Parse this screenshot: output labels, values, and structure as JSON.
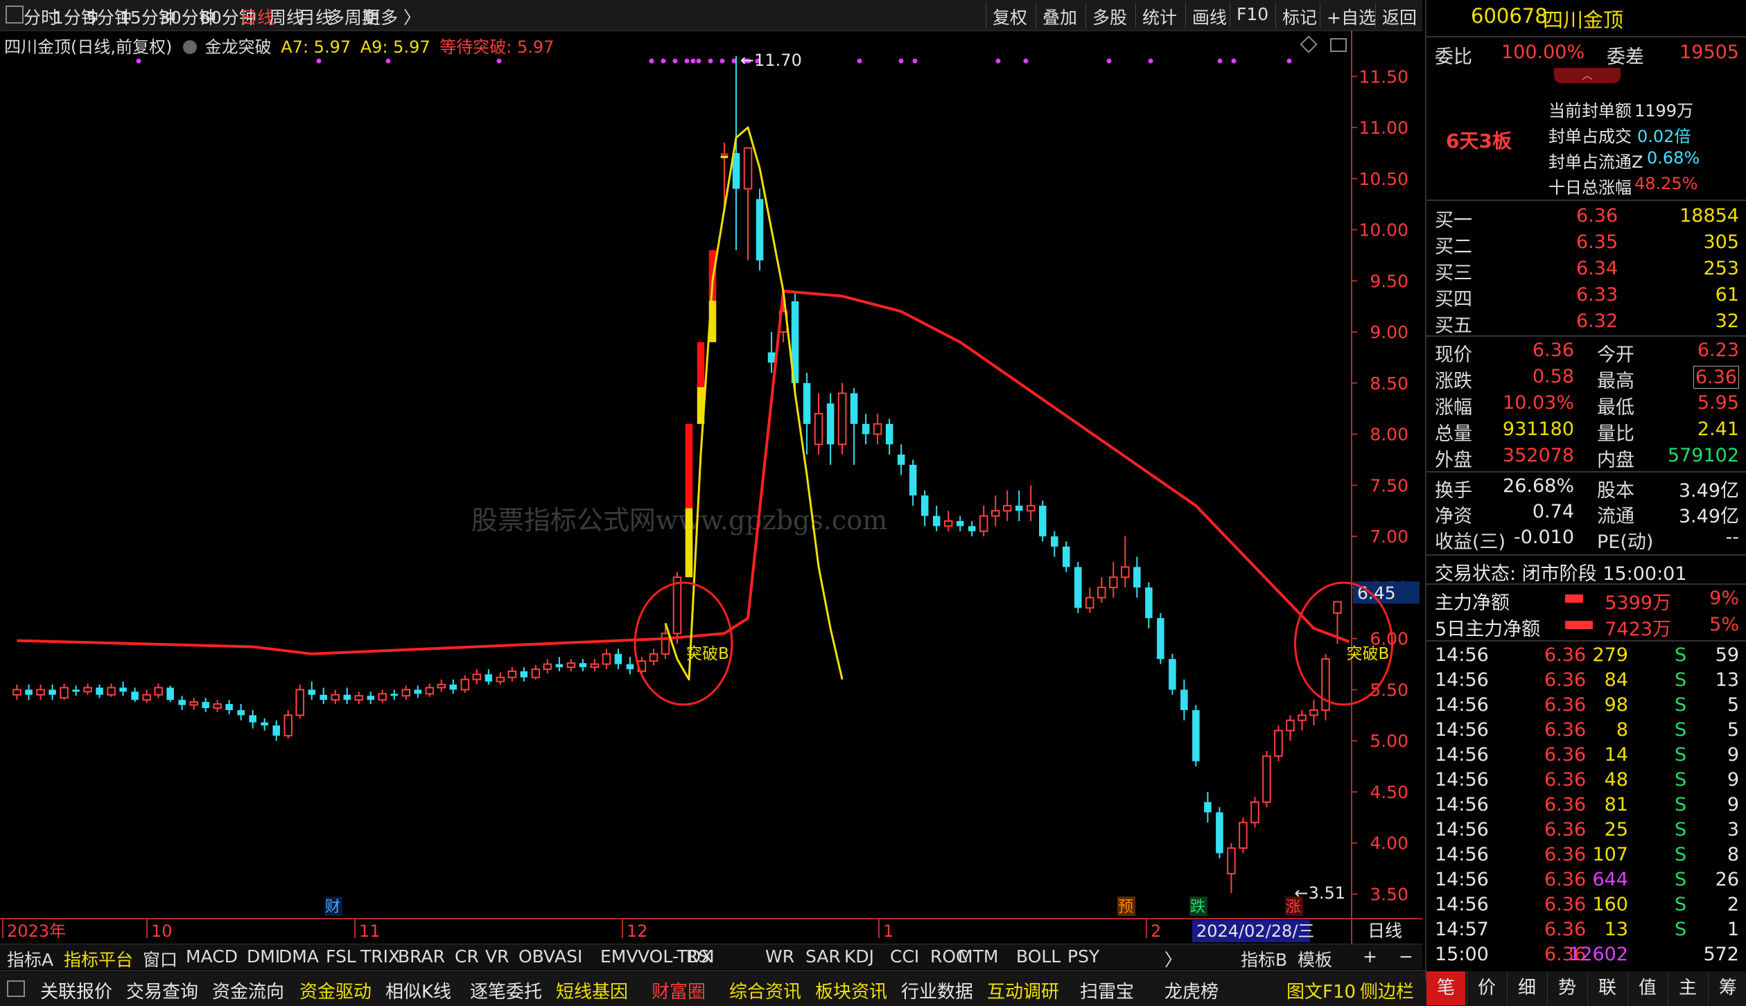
{
  "toolbar": {
    "periods": [
      "分时",
      "1分钟",
      "5分钟",
      "15分钟",
      "30分钟",
      "60分钟",
      "日线",
      "周线",
      "月线",
      "多周期",
      "更多 〉"
    ],
    "active_period": "日线",
    "right_buttons": [
      "复权",
      "叠加",
      "多股",
      "统计",
      "画线",
      "F10",
      "标记",
      "+自选",
      "返回"
    ]
  },
  "legend": {
    "stock_title": "四川金顶(日线,前复权)",
    "indicator_name": "金龙突破",
    "a7": "A7: 5.97",
    "a9": "A9: 5.97",
    "wait": "等待突破: 5.97"
  },
  "watermark": "股票指标公式网www.gpzbgs.com",
  "chart_data": {
    "type": "candlestick",
    "y_ticks": [
      3.5,
      4.0,
      4.5,
      5.0,
      5.5,
      6.0,
      6.5,
      7.0,
      7.5,
      8.0,
      8.5,
      9.0,
      9.5,
      10.0,
      10.5,
      11.0,
      11.5
    ],
    "y_tick_labels": [
      "3.50",
      "4.00",
      "4.50",
      "5.00",
      "5.50",
      "6.00",
      "6.50",
      "7.00",
      "7.50",
      "8.00",
      "8.50",
      "9.00",
      "9.50",
      "10.00",
      "10.50",
      "11.00",
      "11.50"
    ],
    "ylim": [
      3.3,
      11.8
    ],
    "current_price_label": "6.45",
    "high_label": "11.70",
    "low_label": "3.51",
    "candles": [
      [
        5.45,
        5.5,
        5.55,
        5.4
      ],
      [
        5.5,
        5.45,
        5.55,
        5.4
      ],
      [
        5.45,
        5.5,
        5.55,
        5.4
      ],
      [
        5.5,
        5.45,
        5.55,
        5.4
      ],
      [
        5.42,
        5.52,
        5.56,
        5.4
      ],
      [
        5.5,
        5.48,
        5.54,
        5.44
      ],
      [
        5.48,
        5.52,
        5.56,
        5.45
      ],
      [
        5.52,
        5.45,
        5.55,
        5.42
      ],
      [
        5.45,
        5.52,
        5.56,
        5.43
      ],
      [
        5.52,
        5.48,
        5.58,
        5.44
      ],
      [
        5.48,
        5.4,
        5.52,
        5.38
      ],
      [
        5.4,
        5.45,
        5.5,
        5.37
      ],
      [
        5.45,
        5.52,
        5.56,
        5.42
      ],
      [
        5.52,
        5.4,
        5.54,
        5.38
      ],
      [
        5.4,
        5.35,
        5.44,
        5.3
      ],
      [
        5.35,
        5.38,
        5.42,
        5.3
      ],
      [
        5.38,
        5.32,
        5.42,
        5.28
      ],
      [
        5.32,
        5.36,
        5.4,
        5.28
      ],
      [
        5.36,
        5.3,
        5.4,
        5.26
      ],
      [
        5.3,
        5.25,
        5.36,
        5.2
      ],
      [
        5.25,
        5.18,
        5.3,
        5.12
      ],
      [
        5.18,
        5.15,
        5.22,
        5.1
      ],
      [
        5.15,
        5.05,
        5.2,
        5.0
      ],
      [
        5.05,
        5.25,
        5.3,
        5.02
      ],
      [
        5.25,
        5.5,
        5.55,
        5.22
      ],
      [
        5.5,
        5.45,
        5.58,
        5.4
      ],
      [
        5.45,
        5.4,
        5.52,
        5.36
      ],
      [
        5.4,
        5.45,
        5.5,
        5.36
      ],
      [
        5.45,
        5.4,
        5.52,
        5.36
      ],
      [
        5.4,
        5.44,
        5.48,
        5.36
      ],
      [
        5.44,
        5.4,
        5.48,
        5.36
      ],
      [
        5.4,
        5.46,
        5.5,
        5.37
      ],
      [
        5.46,
        5.44,
        5.5,
        5.4
      ],
      [
        5.44,
        5.5,
        5.54,
        5.4
      ],
      [
        5.5,
        5.46,
        5.54,
        5.42
      ],
      [
        5.46,
        5.52,
        5.56,
        5.43
      ],
      [
        5.52,
        5.55,
        5.6,
        5.48
      ],
      [
        5.55,
        5.5,
        5.6,
        5.46
      ],
      [
        5.5,
        5.6,
        5.64,
        5.47
      ],
      [
        5.6,
        5.65,
        5.7,
        5.55
      ],
      [
        5.65,
        5.58,
        5.7,
        5.55
      ],
      [
        5.58,
        5.62,
        5.67,
        5.55
      ],
      [
        5.62,
        5.68,
        5.72,
        5.58
      ],
      [
        5.68,
        5.62,
        5.72,
        5.58
      ],
      [
        5.62,
        5.7,
        5.74,
        5.6
      ],
      [
        5.7,
        5.75,
        5.8,
        5.66
      ],
      [
        5.75,
        5.72,
        5.82,
        5.68
      ],
      [
        5.72,
        5.76,
        5.8,
        5.68
      ],
      [
        5.76,
        5.72,
        5.8,
        5.68
      ],
      [
        5.72,
        5.75,
        5.8,
        5.68
      ],
      [
        5.75,
        5.85,
        5.9,
        5.7
      ],
      [
        5.85,
        5.75,
        5.9,
        5.7
      ],
      [
        5.75,
        5.7,
        5.82,
        5.65
      ],
      [
        5.68,
        5.78,
        5.82,
        5.65
      ],
      [
        5.78,
        5.85,
        5.9,
        5.74
      ],
      [
        5.85,
        6.05,
        6.15,
        5.8
      ],
      [
        6.05,
        6.6,
        6.65,
        5.95
      ],
      [
        6.6,
        8.1,
        8.1,
        6.6
      ],
      [
        8.1,
        8.9,
        8.9,
        8.1
      ],
      [
        8.9,
        9.8,
        9.8,
        8.9
      ],
      [
        10.7,
        10.75,
        10.85,
        10.2
      ],
      [
        10.75,
        10.4,
        11.7,
        9.8
      ],
      [
        10.4,
        10.8,
        10.8,
        9.7
      ],
      [
        10.3,
        9.7,
        10.4,
        9.6
      ],
      [
        8.8,
        8.7,
        9.0,
        8.6
      ],
      [
        9.0,
        9.2,
        9.4,
        8.9
      ],
      [
        9.3,
        8.5,
        9.4,
        8.4
      ],
      [
        8.5,
        8.1,
        8.6,
        7.8
      ],
      [
        7.9,
        8.2,
        8.4,
        7.8
      ],
      [
        8.3,
        7.9,
        8.4,
        7.7
      ],
      [
        7.9,
        8.4,
        8.5,
        7.8
      ],
      [
        8.4,
        8.1,
        8.45,
        7.7
      ],
      [
        8.1,
        8.0,
        8.2,
        7.9
      ],
      [
        8.0,
        8.1,
        8.2,
        7.9
      ],
      [
        8.1,
        7.9,
        8.15,
        7.8
      ],
      [
        7.8,
        7.7,
        7.9,
        7.6
      ],
      [
        7.7,
        7.4,
        7.75,
        7.3
      ],
      [
        7.4,
        7.2,
        7.45,
        7.1
      ],
      [
        7.2,
        7.1,
        7.3,
        7.05
      ],
      [
        7.1,
        7.15,
        7.25,
        7.05
      ],
      [
        7.15,
        7.1,
        7.2,
        7.05
      ],
      [
        7.1,
        7.05,
        7.15,
        7.0
      ],
      [
        7.05,
        7.2,
        7.3,
        7.0
      ],
      [
        7.2,
        7.25,
        7.4,
        7.1
      ],
      [
        7.25,
        7.3,
        7.45,
        7.15
      ],
      [
        7.3,
        7.25,
        7.45,
        7.15
      ],
      [
        7.25,
        7.3,
        7.5,
        7.15
      ],
      [
        7.3,
        7.0,
        7.35,
        6.95
      ],
      [
        7.0,
        6.9,
        7.05,
        6.8
      ],
      [
        6.9,
        6.7,
        6.95,
        6.65
      ],
      [
        6.7,
        6.3,
        6.75,
        6.25
      ],
      [
        6.3,
        6.4,
        6.5,
        6.25
      ],
      [
        6.4,
        6.5,
        6.6,
        6.35
      ],
      [
        6.5,
        6.6,
        6.75,
        6.4
      ],
      [
        6.6,
        6.7,
        7.0,
        6.5
      ],
      [
        6.7,
        6.5,
        6.8,
        6.4
      ],
      [
        6.5,
        6.2,
        6.55,
        6.1
      ],
      [
        6.2,
        5.8,
        6.25,
        5.75
      ],
      [
        5.8,
        5.5,
        5.85,
        5.45
      ],
      [
        5.5,
        5.3,
        5.6,
        5.2
      ],
      [
        5.3,
        4.8,
        5.35,
        4.75
      ],
      [
        4.4,
        4.3,
        4.5,
        4.2
      ],
      [
        4.3,
        3.9,
        4.35,
        3.85
      ],
      [
        3.7,
        3.95,
        4.0,
        3.51
      ],
      [
        3.95,
        4.2,
        4.25,
        3.9
      ],
      [
        4.2,
        4.4,
        4.45,
        4.15
      ],
      [
        4.4,
        4.85,
        4.9,
        4.35
      ],
      [
        4.85,
        5.1,
        5.15,
        4.8
      ],
      [
        5.1,
        5.2,
        5.25,
        5.0
      ],
      [
        5.2,
        5.25,
        5.3,
        5.1
      ],
      [
        5.25,
        5.3,
        5.4,
        5.15
      ],
      [
        5.3,
        5.8,
        5.85,
        5.2
      ],
      [
        6.25,
        6.36,
        6.36,
        5.95
      ]
    ],
    "limit_up_candles": [
      57,
      58,
      59,
      60
    ],
    "series": [
      {
        "name": "A7",
        "color": "#ff2222",
        "x": [
          0,
          20,
          25,
          35,
          45,
          55,
          60,
          62,
          65,
          70,
          75,
          80,
          85,
          90,
          95,
          100,
          105,
          110,
          113
        ],
        "values": [
          5.98,
          5.92,
          5.85,
          5.9,
          5.95,
          6.0,
          6.05,
          6.2,
          9.4,
          9.35,
          9.2,
          8.9,
          8.5,
          8.1,
          7.7,
          7.3,
          6.7,
          6.1,
          5.97
        ]
      },
      {
        "name": "A9",
        "color": "#f0e000",
        "x": [
          55,
          56,
          57,
          58,
          59,
          60,
          61,
          62,
          63,
          64,
          65,
          66,
          67,
          68,
          69,
          70
        ],
        "values": [
          6.15,
          5.8,
          5.6,
          7.8,
          9.5,
          10.2,
          10.9,
          11.0,
          10.6,
          10.0,
          9.4,
          8.4,
          7.6,
          6.7,
          6.1,
          5.6
        ]
      }
    ],
    "circle_labels": [
      "突破B",
      "突破B"
    ],
    "bottom_markers": [
      {
        "text": "财",
        "color": "#44aaff"
      },
      {
        "text": "预",
        "color": "#ff8800"
      },
      {
        "text": "跌",
        "color": "#22dd66"
      },
      {
        "text": "涨",
        "color": "#ff3b3b"
      }
    ],
    "x_axis_labels": [
      "2023年",
      "10",
      "11",
      "12",
      "1",
      "2"
    ],
    "x_axis_cursor_date": "2024/02/28/三",
    "period_label": "日线"
  },
  "indicator_bar": {
    "left": [
      "指标A",
      "指标平台",
      "窗口",
      "MACD",
      "DMI",
      "DMA",
      "FSL",
      "TRIX",
      "BRAR",
      "CR",
      "VR",
      "OBV",
      "ASI",
      "EMV",
      "VOL-TDX",
      "RSI",
      "WR",
      "SAR",
      "KDJ",
      "CCI",
      "ROC",
      "MTM",
      "BOLL",
      "PSY",
      "〉"
    ],
    "active": "指标平台",
    "right": [
      "指标B",
      "模板",
      "+",
      "−"
    ]
  },
  "function_bar": [
    "关联报价",
    "交易查询",
    "资金流向",
    "资金驱动",
    "相似K线",
    "逐笔委托",
    "短线基因",
    "财富圈",
    "综合资讯",
    "板块资讯",
    "行业数据",
    "互动调研",
    "扫雷宝",
    "龙虎榜",
    "图文F10",
    "侧边栏"
  ],
  "right_panel": {
    "code": "600678",
    "name": "四川金顶",
    "weibi_label": "委比",
    "weibi": "100.00%",
    "weicha_label": "委差",
    "weicha": "19505",
    "board_tag": "6天3板",
    "seal_info": [
      {
        "label": "当前封单额",
        "value": "1199万"
      },
      {
        "label": "封单占成交",
        "value": "0.02倍"
      },
      {
        "label": "封单占流通Z",
        "value": "0.68%"
      },
      {
        "label": "十日总涨幅",
        "value": "48.25%"
      }
    ],
    "bids": [
      {
        "label": "买一",
        "price": "6.36",
        "vol": "18854"
      },
      {
        "label": "买二",
        "price": "6.35",
        "vol": "305"
      },
      {
        "label": "买三",
        "price": "6.34",
        "vol": "253"
      },
      {
        "label": "买四",
        "price": "6.33",
        "vol": "61"
      },
      {
        "label": "买五",
        "price": "6.32",
        "vol": "32"
      }
    ],
    "quote": [
      {
        "l1": "现价",
        "v1": "6.36",
        "l2": "今开",
        "v2": "6.23"
      },
      {
        "l1": "涨跌",
        "v1": "0.58",
        "l2": "最高",
        "v2": "6.36"
      },
      {
        "l1": "涨幅",
        "v1": "10.03%",
        "l2": "最低",
        "v2": "5.95"
      },
      {
        "l1": "总量",
        "v1": "931180",
        "l2": "量比",
        "v2": "2.41"
      },
      {
        "l1": "外盘",
        "v1": "352078",
        "l2": "内盘",
        "v2": "579102"
      }
    ],
    "fundamentals": [
      {
        "l1": "换手",
        "v1": "26.68%",
        "l2": "股本",
        "v2": "3.49亿"
      },
      {
        "l1": "净资",
        "v1": "0.74",
        "l2": "流通",
        "v2": "3.49亿"
      },
      {
        "l1": "收益(三)",
        "v1": "-0.010",
        "l2": "PE(动)",
        "v2": "--"
      }
    ],
    "status": "交易状态: 闭市阶段 15:00:01",
    "main_funds": [
      {
        "label": "主力净额",
        "value": "5399万",
        "pct": "9%"
      },
      {
        "label": "5日主力净额",
        "value": "7423万",
        "pct": "5%"
      }
    ],
    "ticks": [
      {
        "time": "14:56",
        "price": "6.36",
        "vol": "279",
        "side": "S",
        "num": "59"
      },
      {
        "time": "14:56",
        "price": "6.36",
        "vol": "84",
        "side": "S",
        "num": "13"
      },
      {
        "time": "14:56",
        "price": "6.36",
        "vol": "98",
        "side": "S",
        "num": "5"
      },
      {
        "time": "14:56",
        "price": "6.36",
        "vol": "8",
        "side": "S",
        "num": "5"
      },
      {
        "time": "14:56",
        "price": "6.36",
        "vol": "14",
        "side": "S",
        "num": "9"
      },
      {
        "time": "14:56",
        "price": "6.36",
        "vol": "48",
        "side": "S",
        "num": "9"
      },
      {
        "time": "14:56",
        "price": "6.36",
        "vol": "81",
        "side": "S",
        "num": "9"
      },
      {
        "time": "14:56",
        "price": "6.36",
        "vol": "25",
        "side": "S",
        "num": "3"
      },
      {
        "time": "14:56",
        "price": "6.36",
        "vol": "107",
        "side": "S",
        "num": "8"
      },
      {
        "time": "14:56",
        "price": "6.36",
        "vol": "644",
        "side": "S",
        "num": "26"
      },
      {
        "time": "14:56",
        "price": "6.36",
        "vol": "160",
        "side": "S",
        "num": "2"
      },
      {
        "time": "14:57",
        "price": "6.36",
        "vol": "13",
        "side": "S",
        "num": "1"
      },
      {
        "time": "15:00",
        "price": "6.36",
        "vol": "12602",
        "side": "",
        "num": "572"
      }
    ],
    "bottom_tabs": [
      "笔",
      "价",
      "细",
      "势",
      "联",
      "值",
      "主",
      "筹"
    ]
  }
}
